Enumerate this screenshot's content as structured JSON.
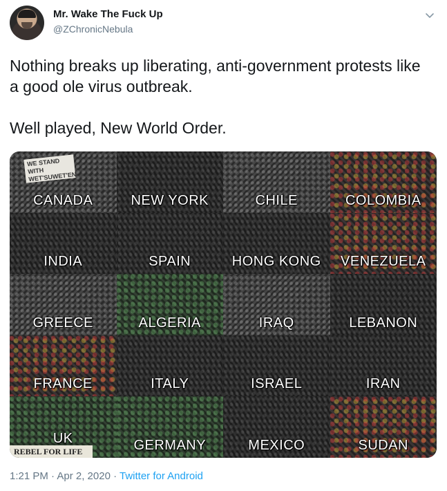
{
  "tweet": {
    "author": {
      "display_name": "Mr. Wake The Fuck Up",
      "handle": "@ZChronicNebula"
    },
    "text_lines": [
      "Nothing breaks up liberating, anti-government protests like a good ole virus outbreak.",
      "Well played, New World Order."
    ],
    "media": {
      "sign_text": "WE STAND WITH WET'SUWET'EN",
      "rebel_sign_text": "REBEL FOR LIFE",
      "tiles": [
        {
          "label": "CANADA",
          "style": "sky"
        },
        {
          "label": "NEW YORK",
          "style": "dark"
        },
        {
          "label": "CHILE",
          "style": "sky"
        },
        {
          "label": "COLOMBIA",
          "style": "color"
        },
        {
          "label": "INDIA",
          "style": "dark"
        },
        {
          "label": "SPAIN",
          "style": "dark"
        },
        {
          "label": "HONG KONG",
          "style": "dark"
        },
        {
          "label": "VENEZUELA",
          "style": "color"
        },
        {
          "label": "GREECE",
          "style": "sky"
        },
        {
          "label": "ALGERIA",
          "style": "green"
        },
        {
          "label": "IRAQ",
          "style": "sky"
        },
        {
          "label": "LEBANON",
          "style": "dark"
        },
        {
          "label": "FRANCE",
          "style": "color"
        },
        {
          "label": "ITALY",
          "style": "dark"
        },
        {
          "label": "ISRAEL",
          "style": "dark"
        },
        {
          "label": "IRAN",
          "style": "dark"
        },
        {
          "label": "UK",
          "style": "green"
        },
        {
          "label": "GERMANY",
          "style": "green"
        },
        {
          "label": "MEXICO",
          "style": "dark"
        },
        {
          "label": "SUDAN",
          "style": "color"
        }
      ]
    },
    "timestamp": "1:21 PM · Apr 2, 2020",
    "separator": " · ",
    "source": "Twitter for Android"
  },
  "icons": {
    "avatar": "profile-photo",
    "more": "chevron-down-icon"
  }
}
